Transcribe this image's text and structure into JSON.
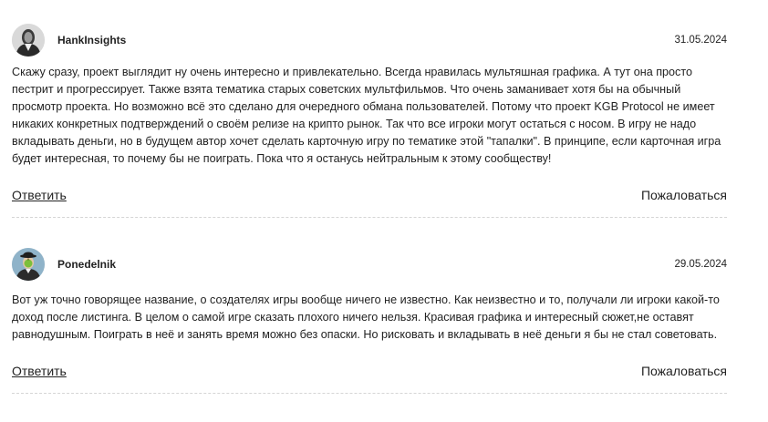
{
  "comments": [
    {
      "author": "HankInsights",
      "date": "31.05.2024",
      "avatar_icon": "portrait-bw-avatar",
      "text": "Скажу сразу, проект выглядит ну очень интересно и привлекательно. Всегда нравилась мультяшная графика. А тут она просто пестрит и прогрессирует. Также взята тематика старых советских мультфильмов. Что очень заманивает хотя бы на обычный просмотр проекта. Но возможно всё это сделано для очередного обмана пользователей. Потому что проект KGB Protocol не имеет никаких конкретных подтверждений о своём релизе на крипто рынок. Так что все игроки могут остаться с носом. В игру не надо вкладывать деньги, но в будущем автор хочет сделать карточную игру по тематике этой \"тапалки\". В принципе, если карточная игра будет интересная, то почему бы не поиграть. Пока что я останусь нейтральным к этому сообществу!",
      "reply_label": "Ответить",
      "report_label": "Пожаловаться"
    },
    {
      "author": "Ponedelnik",
      "date": "29.05.2024",
      "avatar_icon": "bowler-hat-apple-avatar",
      "text": "Вот уж точно говорящее название, о создателях игры вообще ничего не известно. Как неизвестно и то, получали ли игроки какой-то доход после листинга. В целом о самой игре сказать плохого ничего нельзя. Красивая графика и интересный сюжет,не оставят равнодушным. Поиграть в неё и занять время можно без опаски. Но рисковать и вкладывать в неё деньги я бы не стал советовать.",
      "reply_label": "Ответить",
      "report_label": "Пожаловаться"
    }
  ]
}
